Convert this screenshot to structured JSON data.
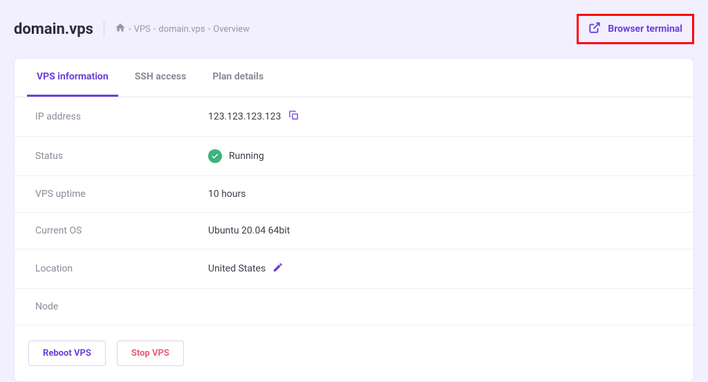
{
  "header": {
    "title": "domain.vps",
    "breadcrumb": {
      "sep1": " - ",
      "item1": "VPS",
      "sep2": " - ",
      "item2": "domain.vps",
      "sep3": " - ",
      "item3": "Overview"
    },
    "browser_terminal_label": "Browser terminal"
  },
  "tabs": {
    "t0": "VPS information",
    "t1": "SSH access",
    "t2": "Plan details"
  },
  "info": {
    "ip": {
      "label": "IP address",
      "value": "123.123.123.123"
    },
    "status": {
      "label": "Status",
      "value": "Running"
    },
    "uptime": {
      "label": "VPS uptime",
      "value": "10 hours"
    },
    "os": {
      "label": "Current OS",
      "value": "Ubuntu 20.04 64bit"
    },
    "location": {
      "label": "Location",
      "value": "United States"
    },
    "node": {
      "label": "Node",
      "value": ""
    }
  },
  "actions": {
    "reboot": "Reboot VPS",
    "stop": "Stop VPS"
  }
}
